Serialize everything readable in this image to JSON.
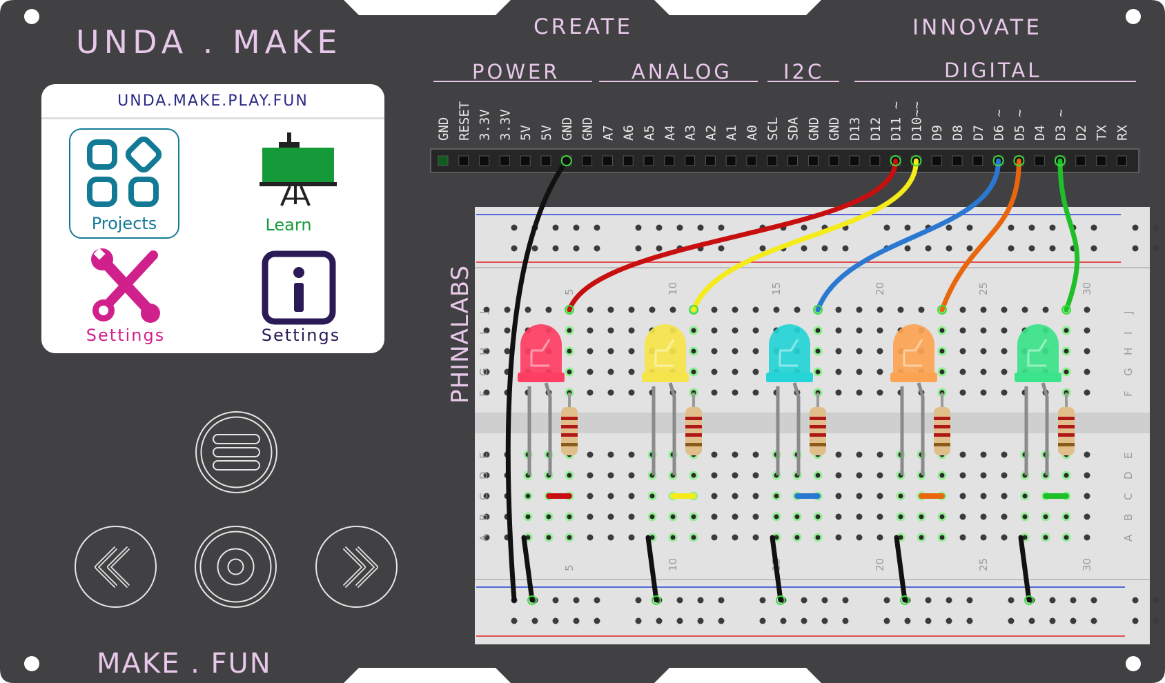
{
  "brand": {
    "title": "UNDA . MAKE",
    "footer": "MAKE . FUN",
    "create": "CREATE",
    "innovate": "INNOVATE",
    "side_label": "PHINALABS"
  },
  "header_groups": [
    {
      "id": "power",
      "label": "POWER"
    },
    {
      "id": "analog",
      "label": "ANALOG"
    },
    {
      "id": "i2c",
      "label": "I2C"
    },
    {
      "id": "digital",
      "label": "DIGITAL"
    }
  ],
  "pins": [
    "GND",
    "RESET",
    "3.3V",
    "3.3V",
    "5V",
    "5V",
    "GND",
    "GND",
    "A7",
    "A6",
    "A5",
    "A4",
    "A3",
    "A2",
    "A1",
    "A0",
    "SCL",
    "SDA",
    "GND",
    "GND",
    "D13",
    "D12",
    "D11 ~",
    "D10~~",
    "D9",
    "D8",
    "D7",
    "D6 ~",
    "D5 ~",
    "D4",
    "D3 ~",
    "D2",
    "TX",
    "RX"
  ],
  "screen": {
    "title": "UNDA.MAKE.PLAY.FUN",
    "tiles": [
      {
        "id": "projects",
        "label": "Projects",
        "icon": "grid-icon",
        "color": "#137a96"
      },
      {
        "id": "learn",
        "label": "Learn",
        "icon": "easel-icon",
        "color": "#159a3a"
      },
      {
        "id": "settings-tools",
        "label": "Settings",
        "icon": "tools-icon",
        "color": "#d0208c"
      },
      {
        "id": "settings-info",
        "label": "Settings",
        "icon": "info-icon",
        "color": "#2a1a55"
      }
    ]
  },
  "controls": {
    "menu": "menu-icon",
    "previous": "double-chevron-left-icon",
    "select": "target-icon",
    "next": "double-chevron-right-icon"
  },
  "breadboard": {
    "column_numbers": [
      "5",
      "10",
      "15",
      "20",
      "25",
      "30"
    ],
    "row_letters_top": [
      "J",
      "I",
      "H",
      "G",
      "F"
    ],
    "row_letters_bottom": [
      "E",
      "D",
      "C",
      "B",
      "A"
    ]
  },
  "circuits": [
    {
      "led": "red",
      "led_color": "#ff3e63",
      "wire_color": "#c80f0f",
      "pin": "D11 ~"
    },
    {
      "led": "yellow",
      "led_color": "#f6e54a",
      "wire_color": "#f5ea1a",
      "pin": "D10~~"
    },
    {
      "led": "cyan",
      "led_color": "#25d4d6",
      "wire_color": "#2a78d2",
      "pin": "D6 ~"
    },
    {
      "led": "orange",
      "led_color": "#fca452",
      "wire_color": "#e8660c",
      "pin": "D5 ~"
    },
    {
      "led": "green",
      "led_color": "#3be38a",
      "wire_color": "#1fbf2a",
      "pin": "D3 ~"
    }
  ],
  "colors": {
    "panel": "#414042",
    "accent_text": "#e8c8ea",
    "gnd_wire": "#111111"
  }
}
